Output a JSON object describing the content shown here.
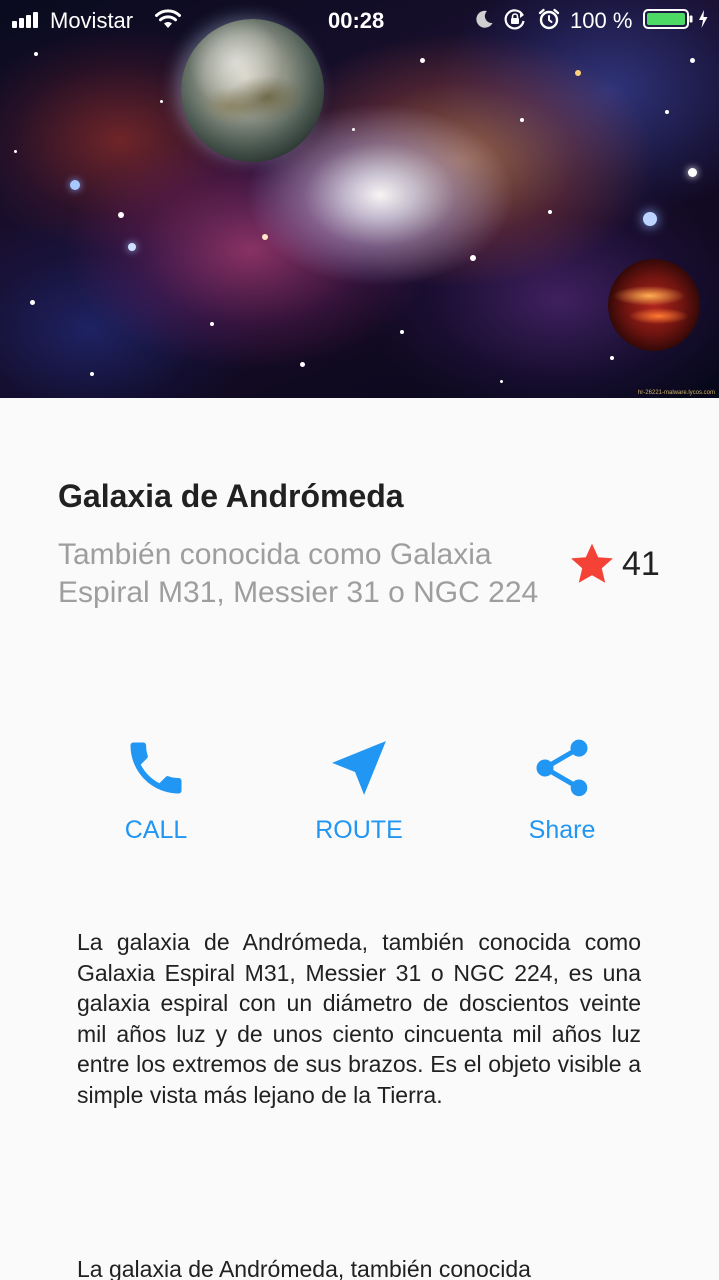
{
  "status_bar": {
    "carrier": "Movistar",
    "time": "00:28",
    "battery_percent": "100 %",
    "battery_level": 1.0,
    "icons": [
      "signal-icon",
      "wifi-icon",
      "moon-icon",
      "rotation-lock-icon",
      "alarm-icon",
      "battery-icon",
      "charging-icon"
    ]
  },
  "hero": {
    "credit": "hr-26221-malware.lycos.com"
  },
  "place": {
    "title": "Galaxia de Andrómeda",
    "subtitle": "También conocida como Galaxia Espiral M31, Messier 31 o NGC 224",
    "favorite_count": "41",
    "star_color": "#f44336"
  },
  "actions": {
    "accent_color": "#2196f3",
    "call_label": "CALL",
    "route_label": "ROUTE",
    "share_label": "Share"
  },
  "description": {
    "paragraphs": [
      "La galaxia de Andrómeda, también conocida como Galaxia Espiral M31, Messier 31 o NGC 224, es una galaxia espiral con un diámetro de doscientos veinte mil años luz y de unos ciento cincuenta mil años luz entre los extremos de sus brazos. Es el objeto visible a simple vista más lejano de la Tierra.",
      "La galaxia de Andrómeda, también conocida"
    ]
  }
}
